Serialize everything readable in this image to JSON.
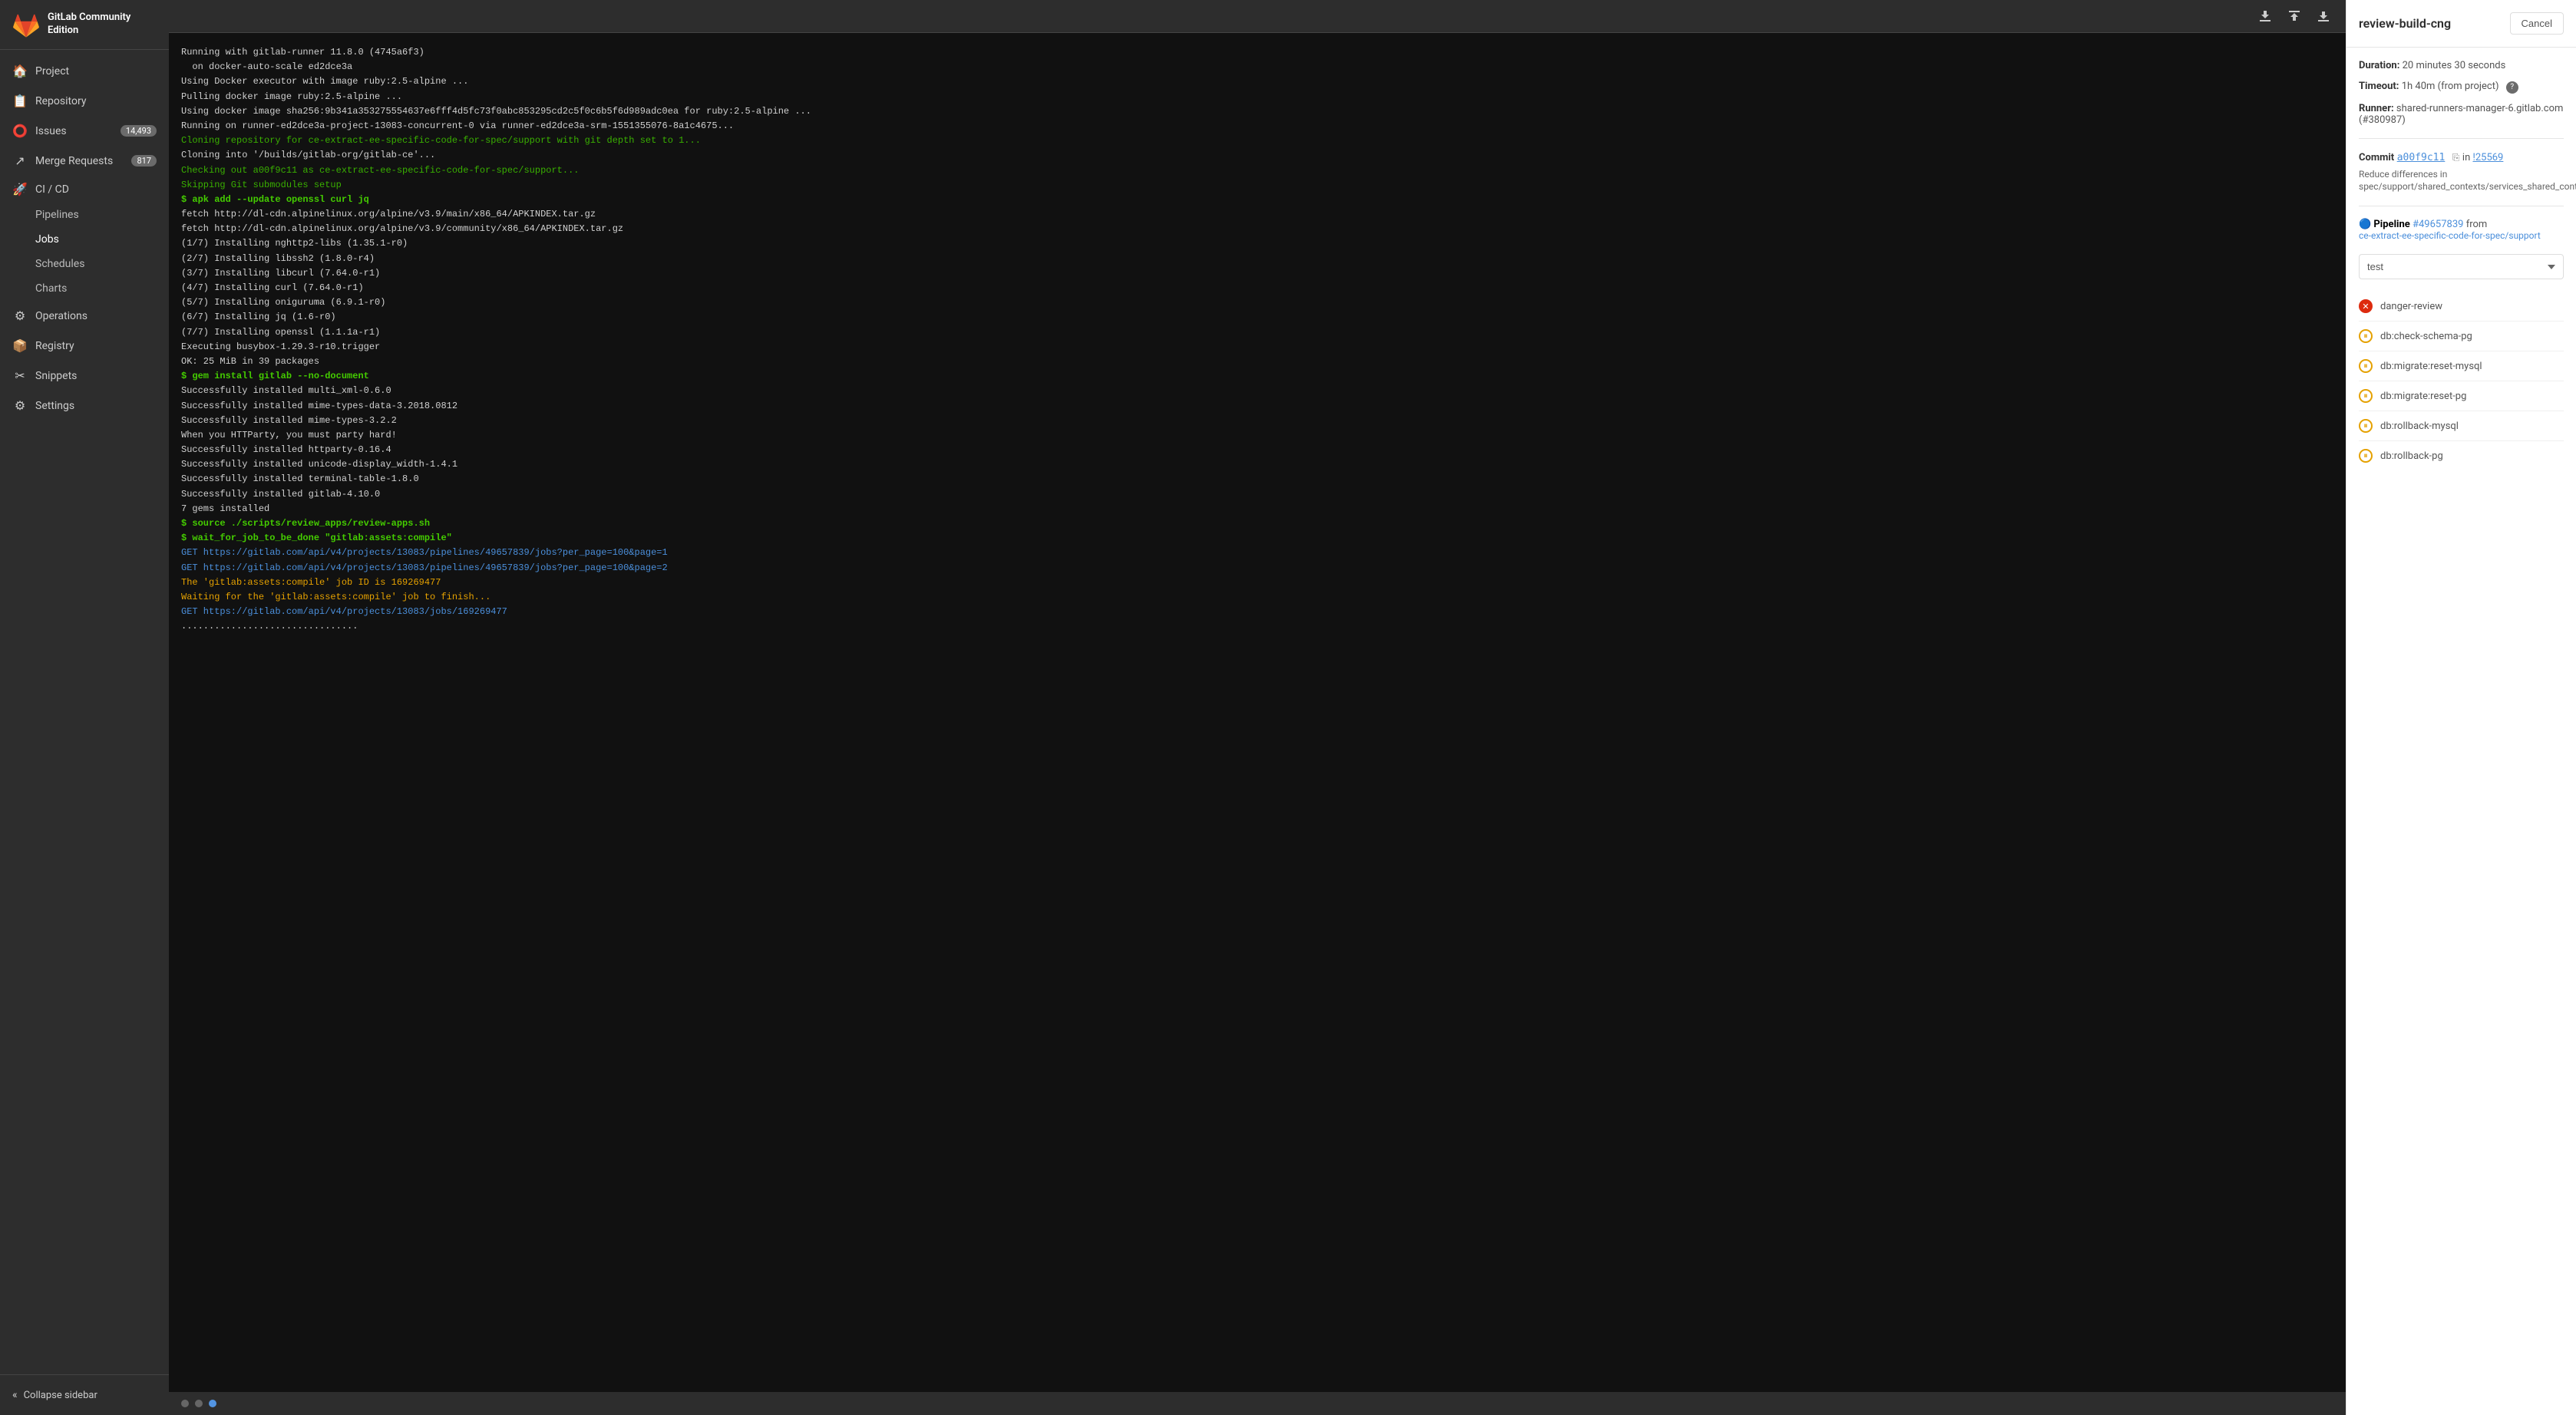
{
  "sidebar": {
    "logo_alt": "GitLab",
    "title_line1": "GitLab Community",
    "title_line2": "Edition",
    "nav_items": [
      {
        "id": "project",
        "label": "Project",
        "icon": "🏠"
      },
      {
        "id": "repository",
        "label": "Repository",
        "icon": "📋"
      },
      {
        "id": "issues",
        "label": "Issues",
        "icon": "⭕",
        "badge": "14,493"
      },
      {
        "id": "merge-requests",
        "label": "Merge Requests",
        "icon": "↗",
        "badge": "817"
      }
    ],
    "cicd_section": {
      "label": "CI / CD",
      "icon": "🚀",
      "sub_items": [
        {
          "id": "pipelines",
          "label": "Pipelines"
        },
        {
          "id": "jobs",
          "label": "Jobs",
          "active": true
        },
        {
          "id": "schedules",
          "label": "Schedules"
        },
        {
          "id": "charts",
          "label": "Charts"
        }
      ]
    },
    "other_items": [
      {
        "id": "operations",
        "label": "Operations",
        "icon": "⚙"
      },
      {
        "id": "registry",
        "label": "Registry",
        "icon": "📦"
      },
      {
        "id": "snippets",
        "label": "Snippets",
        "icon": "✂"
      },
      {
        "id": "settings",
        "label": "Settings",
        "icon": "⚙"
      }
    ],
    "footer": {
      "collapse_label": "Collapse sidebar",
      "icon": "«"
    }
  },
  "terminal": {
    "lines": [
      {
        "text": "Running with gitlab-runner 11.8.0 (4745a6f3)",
        "class": ""
      },
      {
        "text": "  on docker-auto-scale ed2dce3a",
        "class": ""
      },
      {
        "text": "Using Docker executor with image ruby:2.5-alpine ...",
        "class": ""
      },
      {
        "text": "Pulling docker image ruby:2.5-alpine ...",
        "class": ""
      },
      {
        "text": "Using docker image sha256:9b341a353275554637e6fff4d5fc73f0abc853295cd2c5f0c6b5f6d989adc0ea for ruby:2.5-alpine ...",
        "class": ""
      },
      {
        "text": "Running on runner-ed2dce3a-project-13083-concurrent-0 via runner-ed2dce3a-srm-1551355076-8a1c4675...",
        "class": ""
      },
      {
        "text": "Cloning repository for ce-extract-ee-specific-code-for-spec/support with git depth set to 1...",
        "class": "green"
      },
      {
        "text": "Cloning into '/builds/gitlab-org/gitlab-ce'...",
        "class": ""
      },
      {
        "text": "Checking out a00f9c11 as ce-extract-ee-specific-code-for-spec/support...",
        "class": "green"
      },
      {
        "text": "Skipping Git submodules setup",
        "class": "green"
      },
      {
        "text": "$ apk add --update openssl curl jq",
        "class": "bright-green"
      },
      {
        "text": "fetch http://dl-cdn.alpinelinux.org/alpine/v3.9/main/x86_64/APKINDEX.tar.gz",
        "class": ""
      },
      {
        "text": "fetch http://dl-cdn.alpinelinux.org/alpine/v3.9/community/x86_64/APKINDEX.tar.gz",
        "class": ""
      },
      {
        "text": "(1/7) Installing nghttp2-libs (1.35.1-r0)",
        "class": ""
      },
      {
        "text": "(2/7) Installing libssh2 (1.8.0-r4)",
        "class": ""
      },
      {
        "text": "(3/7) Installing libcurl (7.64.0-r1)",
        "class": ""
      },
      {
        "text": "(4/7) Installing curl (7.64.0-r1)",
        "class": ""
      },
      {
        "text": "(5/7) Installing oniguruma (6.9.1-r0)",
        "class": ""
      },
      {
        "text": "(6/7) Installing jq (1.6-r0)",
        "class": ""
      },
      {
        "text": "(7/7) Installing openssl (1.1.1a-r1)",
        "class": ""
      },
      {
        "text": "Executing busybox-1.29.3-r10.trigger",
        "class": ""
      },
      {
        "text": "OK: 25 MiB in 39 packages",
        "class": ""
      },
      {
        "text": "$ gem install gitlab --no-document",
        "class": "bright-green"
      },
      {
        "text": "Successfully installed multi_xml-0.6.0",
        "class": ""
      },
      {
        "text": "Successfully installed mime-types-data-3.2018.0812",
        "class": ""
      },
      {
        "text": "Successfully installed mime-types-3.2.2",
        "class": ""
      },
      {
        "text": "When you HTTParty, you must party hard!",
        "class": ""
      },
      {
        "text": "Successfully installed httparty-0.16.4",
        "class": ""
      },
      {
        "text": "Successfully installed unicode-display_width-1.4.1",
        "class": ""
      },
      {
        "text": "Successfully installed terminal-table-1.8.0",
        "class": ""
      },
      {
        "text": "Successfully installed gitlab-4.10.0",
        "class": ""
      },
      {
        "text": "7 gems installed",
        "class": ""
      },
      {
        "text": "$ source ./scripts/review_apps/review-apps.sh",
        "class": "bright-green"
      },
      {
        "text": "$ wait_for_job_to_be_done \"gitlab:assets:compile\"",
        "class": "bright-green"
      },
      {
        "text": "GET https://gitlab.com/api/v4/projects/13083/pipelines/49657839/jobs?per_page=100&page=1",
        "class": "blue-link"
      },
      {
        "text": "GET https://gitlab.com/api/v4/projects/13083/pipelines/49657839/jobs?per_page=100&page=2",
        "class": "blue-link"
      },
      {
        "text": "The 'gitlab:assets:compile' job ID is 169269477",
        "class": "yellow"
      },
      {
        "text": "Waiting for the 'gitlab:assets:compile' job to finish...",
        "class": "yellow"
      },
      {
        "text": "GET https://gitlab.com/api/v4/projects/13083/jobs/169269477",
        "class": "blue-link"
      },
      {
        "text": "................................",
        "class": ""
      }
    ],
    "footer_dots": [
      {
        "active": false
      },
      {
        "active": false
      },
      {
        "active": true
      }
    ]
  },
  "right_panel": {
    "title": "review-build-cng",
    "cancel_label": "Cancel",
    "duration_label": "Duration:",
    "duration_value": "20 minutes 30 seconds",
    "timeout_label": "Timeout:",
    "timeout_value": "1h 40m (from project)",
    "runner_label": "Runner:",
    "runner_value": "shared-runners-manager-6.gitlab.com (#380987)",
    "commit_hash": "a00f9c11",
    "commit_copy_title": "Copy commit SHA",
    "commit_in": "in",
    "commit_mr": "!25569",
    "commit_message": "Reduce differences in spec/support/shared_contexts/services_shared_context.rb",
    "pipeline_label": "Pipeline",
    "pipeline_id": "#49657839",
    "pipeline_branch": "ce-extract-ee-specific-code-for-spec/support",
    "stage_value": "test",
    "jobs": [
      {
        "id": "danger-review",
        "label": "danger-review",
        "status": "failed"
      },
      {
        "id": "db-check-schema-pg",
        "label": "db:check-schema-pg",
        "status": "pending"
      },
      {
        "id": "db-migrate-reset-mysql",
        "label": "db:migrate:reset-mysql",
        "status": "pending"
      },
      {
        "id": "db-migrate-reset-pg",
        "label": "db:migrate:reset-pg",
        "status": "pending"
      },
      {
        "id": "db-rollback-mysql",
        "label": "db:rollback-mysql",
        "status": "pending"
      },
      {
        "id": "db-rollback-pg",
        "label": "db:rollback-pg",
        "status": "pending"
      }
    ]
  }
}
